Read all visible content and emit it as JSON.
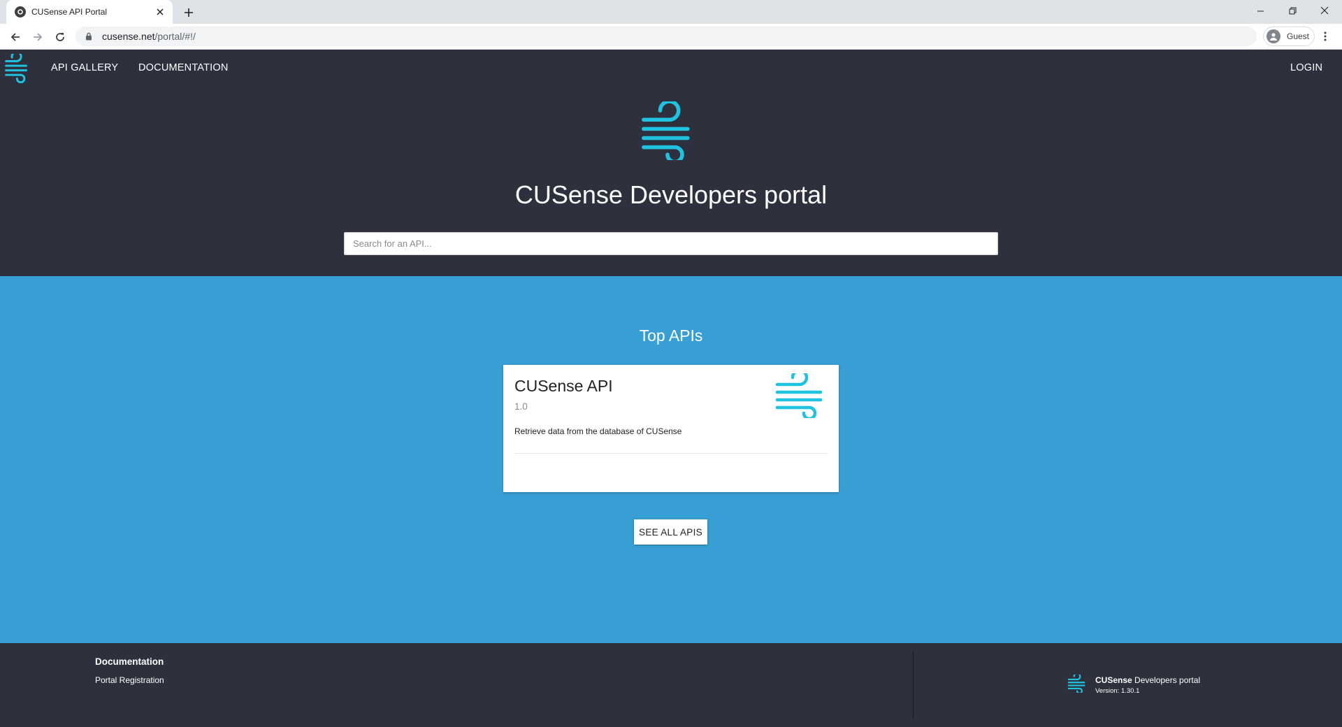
{
  "browser": {
    "tab_title": "CUSense API Portal",
    "url_host": "cusense.net",
    "url_path": "/portal/#!/",
    "profile_label": "Guest"
  },
  "nav": {
    "links": [
      "API GALLERY",
      "DOCUMENTATION"
    ],
    "login": "LOGIN"
  },
  "hero": {
    "title": "CUSense Developers portal",
    "search_placeholder": "Search for an API..."
  },
  "top_apis": {
    "heading": "Top APIs",
    "cards": [
      {
        "name": "CUSense API",
        "version": "1.0",
        "description": "Retrieve data from the database of CUSense"
      }
    ],
    "see_all_label": "SEE ALL APIS"
  },
  "footer": {
    "heading": "Documentation",
    "link": "Portal Registration",
    "brand_bold": "CUSense",
    "brand_rest": " Developers portal",
    "version": "Version: 1.30.1"
  },
  "colors": {
    "header_bg": "#2e313d",
    "section_bg": "#379fd3",
    "logo_accent": "#1fc2df"
  },
  "icons": {
    "logo": "wind-logo-icon"
  }
}
